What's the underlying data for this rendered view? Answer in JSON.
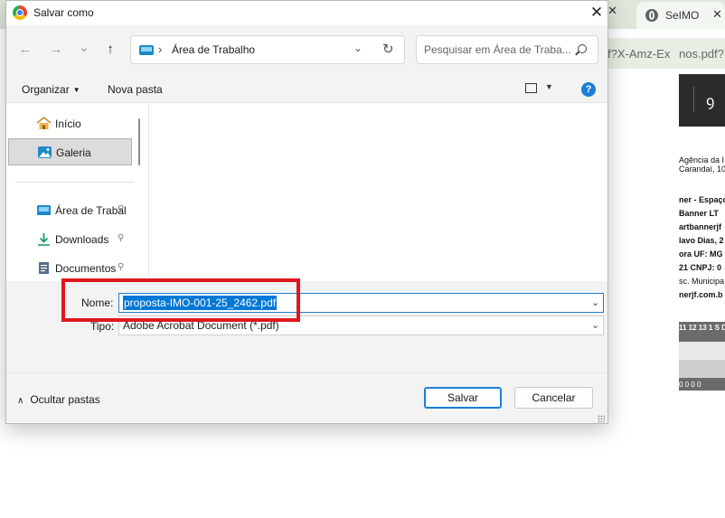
{
  "background": {
    "tab1_close": "✕",
    "tab2_title": "SeIMO",
    "tab2_close": "✕",
    "address_fragment_1": "f?X-Amz-Ex",
    "address_fragment_2": "nos.pdf?",
    "doc_lines": [
      "Agência da I",
      "Carandaí, 100",
      "ner - Espaço",
      "Banner LT",
      "artbannerjf",
      "lavo Dias, 2",
      "ora UF: MG",
      "21 CNPJ: 0",
      "sc. Municipa",
      "nerjf.com.b"
    ],
    "grid_header": "11 12 13 1  S  D  S",
    "grid_footer": "0 0 0 0"
  },
  "dialog": {
    "title": "Salvar como",
    "close_glyph": "✕",
    "nav": {
      "back": "←",
      "forward": "→",
      "recent": "⌄",
      "up": "↑"
    },
    "path": {
      "separator": "›",
      "current": "Área de Trabalho",
      "dropdown_glyph": "⌄",
      "refresh_glyph": "↻"
    },
    "search": {
      "placeholder": "Pesquisar em Área de Traba..."
    },
    "toolbar": {
      "organize": "Organizar",
      "organize_caret": "▼",
      "new_folder": "Nova pasta",
      "view_caret": "▼",
      "help": "?"
    },
    "sidebar": {
      "items": [
        {
          "label": "Início",
          "pinned": false
        },
        {
          "label": "Galeria",
          "pinned": false,
          "selected": true
        },
        {
          "label": "Área de Trabal",
          "pinned": true
        },
        {
          "label": "Downloads",
          "pinned": true
        },
        {
          "label": "Documentos",
          "pinned": true
        }
      ],
      "pin_glyph": "📌"
    },
    "form": {
      "name_label": "Nome:",
      "name_value": "proposta-IMO-001-25_2462.pdf",
      "type_label": "Tipo:",
      "type_value": "Adobe Acrobat Document (*.pdf)",
      "dropdown_glyph": "⌄"
    },
    "footer": {
      "hide_folders": "Ocultar pastas",
      "hide_glyph": "∧",
      "save": "Salvar",
      "cancel": "Cancelar"
    },
    "colors": {
      "accent": "#0078d7",
      "highlight_box": "#e0161e",
      "help_icon": "#1c7ed6"
    }
  }
}
